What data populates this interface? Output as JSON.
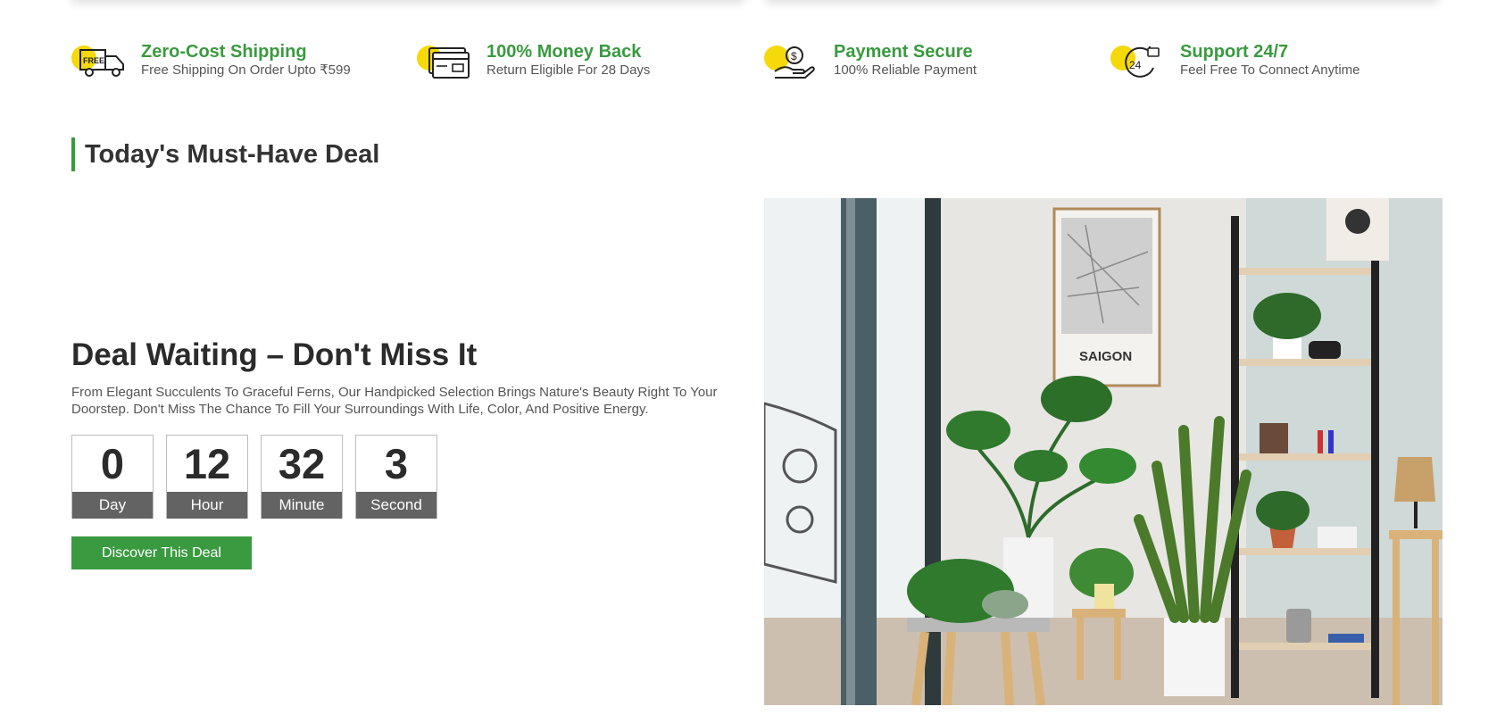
{
  "features": [
    {
      "icon": "free-shipping-truck-icon",
      "title": "Zero-Cost Shipping",
      "subtitle": "Free Shipping On Order Upto ₹599",
      "badge": "FREE"
    },
    {
      "icon": "credit-card-icon",
      "title": "100% Money Back",
      "subtitle": "Return Eligible For 28 Days"
    },
    {
      "icon": "money-hand-icon",
      "title": "Payment Secure",
      "subtitle": "100% Reliable Payment",
      "badge": "$"
    },
    {
      "icon": "support-24-icon",
      "title": "Support 24/7",
      "subtitle": "Feel Free To Connect Anytime",
      "badge": "24"
    }
  ],
  "section": {
    "title": "Today's Must-Have Deal"
  },
  "deal": {
    "heading": "Deal Waiting – Don't Miss It",
    "description": "From Elegant Succulents To Graceful Ferns, Our Handpicked Selection Brings Nature's Beauty Right To Your Doorstep. Don't Miss The Chance To Fill Your Surroundings With Life, Color, And Positive Energy.",
    "countdown": [
      {
        "value": "0",
        "label": "Day"
      },
      {
        "value": "12",
        "label": "Hour"
      },
      {
        "value": "32",
        "label": "Minute"
      },
      {
        "value": "3",
        "label": "Second"
      }
    ],
    "button_label": "Discover This Deal",
    "image": {
      "poster_text": "SAIGON"
    }
  },
  "colors": {
    "accent_green": "#3a9a3f",
    "icon_yellow": "#f5d90a",
    "timer_label_bg": "#636363"
  }
}
